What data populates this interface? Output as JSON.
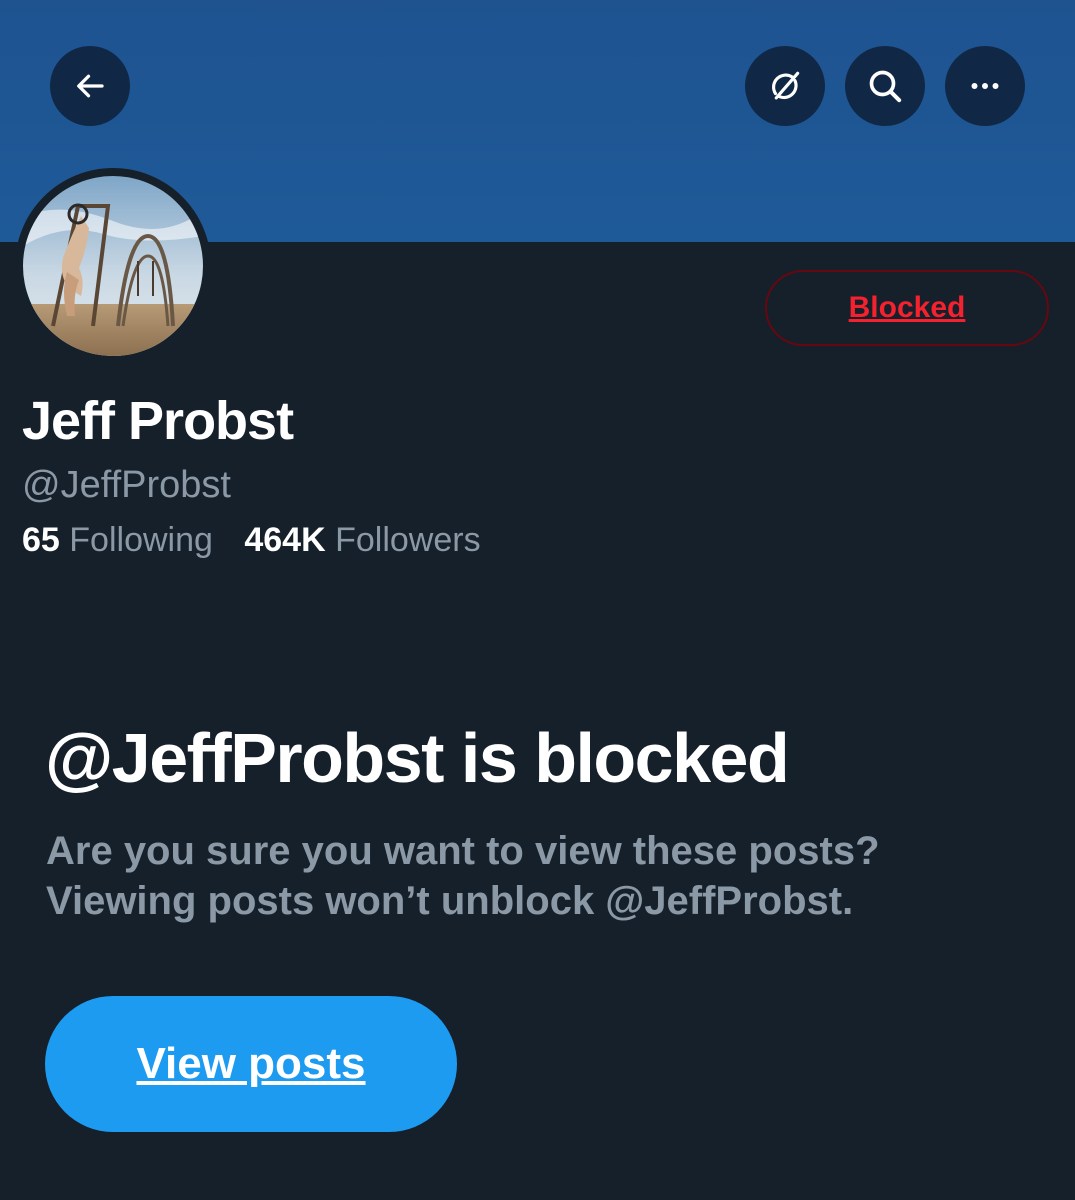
{
  "header": {
    "back_icon": "arrow-left-icon",
    "grok_icon": "grok-slash-icon",
    "search_icon": "search-icon",
    "more_icon": "more-horizontal-icon",
    "banner_color": "#1f5a98"
  },
  "profile": {
    "name": "Jeff Probst",
    "handle": "@JeffProbst",
    "following_count": "65",
    "following_label": "Following",
    "followers_count": "464K",
    "followers_label": "Followers",
    "blocked_button_label": "Blocked"
  },
  "blocked_notice": {
    "title": "@JeffProbst is blocked",
    "line1": "Are you sure you want to view these posts?",
    "line2": "Viewing posts won’t unblock @JeffProbst.",
    "view_posts_label": "View posts"
  },
  "colors": {
    "background": "#15202b",
    "accent": "#1d9bf0",
    "danger": "#f4212e",
    "secondary_text": "#8b98a5"
  }
}
